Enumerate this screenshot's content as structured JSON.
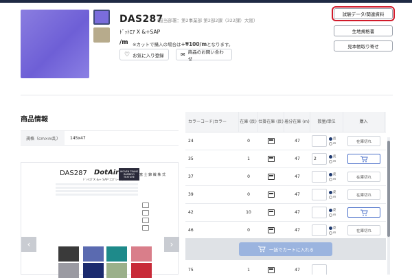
{
  "product": {
    "code": "DAS287",
    "department": "（担当部署：第2事業部 第2部2課（322課）大阪）",
    "subtitle": "ﾄﾞｯﾄｴｱ X &+SAP",
    "unit": "/m",
    "cut_note_prefix": "※カットで購入の場合は",
    "cut_note_price": "+¥100/m",
    "cut_note_suffix": "となります。",
    "favorite_label": "お気に入り登録",
    "contact_label": "商品のお問い合わせ"
  },
  "colors": {
    "fabric_main": "#7a6ddc",
    "highlight": "#d11a2a",
    "accent": "#4a6fc9"
  },
  "right_buttons": {
    "test_data": "試験データ/関連資料",
    "spec_sheet": "生地規格書",
    "sample_order": "見本帳取り寄せ"
  },
  "info": {
    "heading": "商品情報",
    "spec_key": "規格（cm×m乱）",
    "spec_value": "145x47"
  },
  "tag": {
    "code": "DAS287",
    "brand": "DotAir",
    "sub": "ﾄﾞｯﾄｴｱ X &+ SAP ｴｺﾌﾞﾚｰﾄ･ﾌｧｲﾙﾄﾞ",
    "badge": "WOVEN TRANS BAMBOO TEXTURE",
    "stamp": "富 士 錦 織 株 式"
  },
  "table": {
    "headers": {
      "color": "カラーコード/カラー",
      "stock": "在庫 (反)",
      "schedule": "仕掛在庫 (反)",
      "length": "着分在庫 (m)",
      "qty": "数量/単位",
      "buy": "購入"
    },
    "radio_labels": {
      "roll": "反",
      "meter": "m"
    },
    "sold_out": "在庫切れ",
    "rows": [
      {
        "color": "24",
        "stock": "0",
        "length": "47",
        "qty": "",
        "status": "在庫切れ"
      },
      {
        "color": "35",
        "stock": "1",
        "length": "47",
        "qty": "2",
        "status": ""
      },
      {
        "color": "37",
        "stock": "0",
        "length": "47",
        "qty": "",
        "status": "在庫切れ"
      },
      {
        "color": "39",
        "stock": "0",
        "length": "47",
        "qty": "",
        "status": "在庫切れ"
      },
      {
        "color": "42",
        "stock": "10",
        "length": "47",
        "qty": "",
        "status": ""
      },
      {
        "color": "46",
        "stock": "0",
        "length": "47",
        "qty": "",
        "status": "在庫切れ"
      },
      {
        "color": "75",
        "stock": "1",
        "length": "47",
        "qty": "",
        "status": ""
      }
    ],
    "bulk_add_label": "一括でカートに入れる"
  }
}
